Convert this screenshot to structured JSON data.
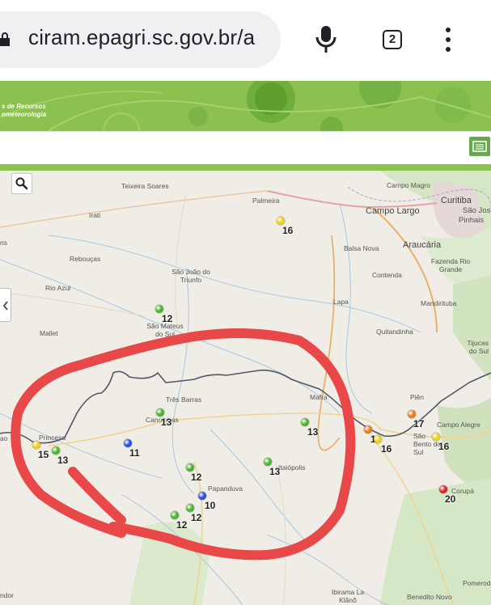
{
  "browser": {
    "url": "ciram.epagri.sc.gov.br/a",
    "tab_count": "2",
    "icons": [
      "lock-icon",
      "microphone-icon",
      "tabs-count-icon",
      "more-menu-icon"
    ]
  },
  "banner": {
    "title_line1": "s de Recursos",
    "title_line2": "ometeorologia"
  },
  "map": {
    "places": [
      {
        "key": "teixeira",
        "name": "Teixeira Soares"
      },
      {
        "key": "palmeira",
        "name": "Palmeira"
      },
      {
        "key": "campomagro",
        "name": "Campo Magro"
      },
      {
        "key": "curitiba",
        "name": "Curitiba"
      },
      {
        "key": "campolargo",
        "name": "Campo Largo"
      },
      {
        "key": "saojose",
        "name": "São José d"
      },
      {
        "key": "pinhais",
        "name": "Pinhais"
      },
      {
        "key": "irati",
        "name": "Irati"
      },
      {
        "key": "ns",
        "name": "ns"
      },
      {
        "key": "reboucas",
        "name": "Rebouças"
      },
      {
        "key": "balsanova",
        "name": "Balsa Nova"
      },
      {
        "key": "araucaria",
        "name": "Araucária"
      },
      {
        "key": "fazenda",
        "name": "Fazenda Rio Grande"
      },
      {
        "key": "contenda",
        "name": "Contenda"
      },
      {
        "key": "saojoao",
        "name": "São João do Triunfo"
      },
      {
        "key": "rioazul",
        "name": "Rio Azul"
      },
      {
        "key": "lapa",
        "name": "Lapa"
      },
      {
        "key": "mandirituba",
        "name": "Mandirituba"
      },
      {
        "key": "saomateus",
        "name": "São Mateus do Sul"
      },
      {
        "key": "mallet",
        "name": "Mallet"
      },
      {
        "key": "quitandinha",
        "name": "Quitandinha"
      },
      {
        "key": "tijucas",
        "name": "Tijucas do Sul"
      },
      {
        "key": "tresbarras",
        "name": "Três Barras"
      },
      {
        "key": "canoinhas",
        "name": "Canoinhas"
      },
      {
        "key": "mafra",
        "name": "Mafra"
      },
      {
        "key": "pien",
        "name": "Piên"
      },
      {
        "key": "campoalegre",
        "name": "Campo Alegre"
      },
      {
        "key": "saobento",
        "name": "São Bento do Sul"
      },
      {
        "key": "princesa",
        "name": "Princesa"
      },
      {
        "key": "itaiopolis",
        "name": "Itaiópolis"
      },
      {
        "key": "papanduva",
        "name": "Papanduva"
      },
      {
        "key": "corupa",
        "name": "Corupá"
      },
      {
        "key": "ibirama",
        "name": "Ibirama La Klãnõ"
      },
      {
        "key": "beneditonovo",
        "name": "Benedito Novo"
      },
      {
        "key": "pomerode",
        "name": "Pomerode"
      },
      {
        "key": "ndor",
        "name": "ndor"
      },
      {
        "key": "vtl",
        "name": "ao"
      }
    ],
    "stations": [
      {
        "key": "s1",
        "value": "16",
        "color": "#e8d21a"
      },
      {
        "key": "s2",
        "value": "12",
        "color": "#49b52e"
      },
      {
        "key": "s3",
        "value": "13",
        "color": "#49b52e"
      },
      {
        "key": "s4",
        "value": "11",
        "color": "#2a4fd4"
      },
      {
        "key": "s5",
        "value": "15",
        "color": "#e8d21a"
      },
      {
        "key": "s6",
        "value": "13",
        "color": "#49b52e"
      },
      {
        "key": "s7",
        "value": "13",
        "color": "#49b52e"
      },
      {
        "key": "s8",
        "value": "12",
        "color": "#49b52e"
      },
      {
        "key": "s9",
        "value": "13",
        "color": "#49b52e"
      },
      {
        "key": "s10",
        "value": "10",
        "color": "#2a4fd4"
      },
      {
        "key": "s11",
        "value": "12",
        "color": "#49b52e"
      },
      {
        "key": "s12",
        "value": "12",
        "color": "#49b52e"
      },
      {
        "key": "s13",
        "value": "16",
        "color": "#e87a1f"
      },
      {
        "key": "s14",
        "value": "16",
        "color": "#e8d21a"
      },
      {
        "key": "s15",
        "value": "17",
        "color": "#e87a1f"
      },
      {
        "key": "s16",
        "value": "16",
        "color": "#e8d21a"
      },
      {
        "key": "s17",
        "value": "20",
        "color": "#e0202a"
      }
    ],
    "annotation_color": "#e84848"
  }
}
